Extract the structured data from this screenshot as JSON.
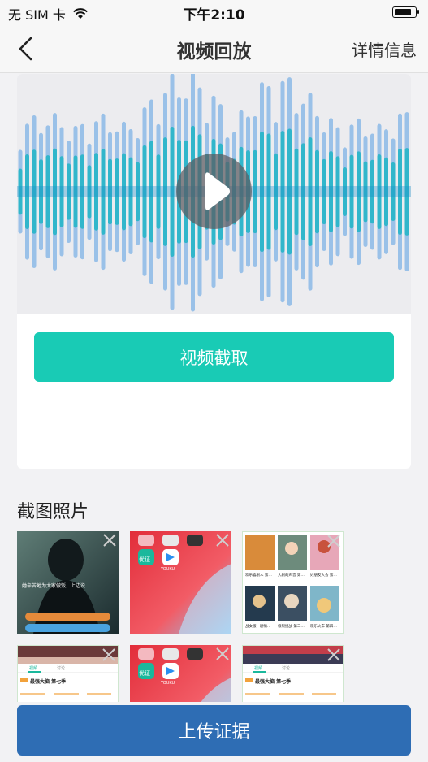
{
  "status_bar": {
    "carrier": "无 SIM 卡",
    "time": "下午2:10",
    "battery_level": 0.85
  },
  "nav": {
    "title": "视频回放",
    "right_label": "详情信息"
  },
  "video": {
    "capture_label": "视频截取"
  },
  "screenshots": {
    "title": "截图照片",
    "items": [
      {
        "type": "movie",
        "caption": "她辛苦地为大家做饭，上边说…"
      },
      {
        "type": "homescreen",
        "app_labels": [
          "优证",
          "YOUKU"
        ]
      },
      {
        "type": "video-grid",
        "labels": [
          "欢乐喜剧人 第…",
          "大剧的声音 第…",
          "好朋友大会 第…",
          "战女版：剧情…",
          "极限挑战 第三…",
          "欢乐火车 第四…"
        ]
      },
      {
        "type": "youku-page",
        "tabs": [
          "视频",
          "讨论"
        ],
        "title": "最强大脑 第七季"
      },
      {
        "type": "homescreen",
        "app_labels": [
          "优证",
          "YOUKU"
        ]
      },
      {
        "type": "youku-page",
        "tabs": [
          "视频",
          "讨论"
        ],
        "title": "最强大脑 第七季"
      }
    ]
  },
  "upload_label": "上传证据",
  "colors": {
    "accent_green": "#19cbb5",
    "primary_blue": "#2e6db4",
    "background": "#f2f2f4"
  }
}
